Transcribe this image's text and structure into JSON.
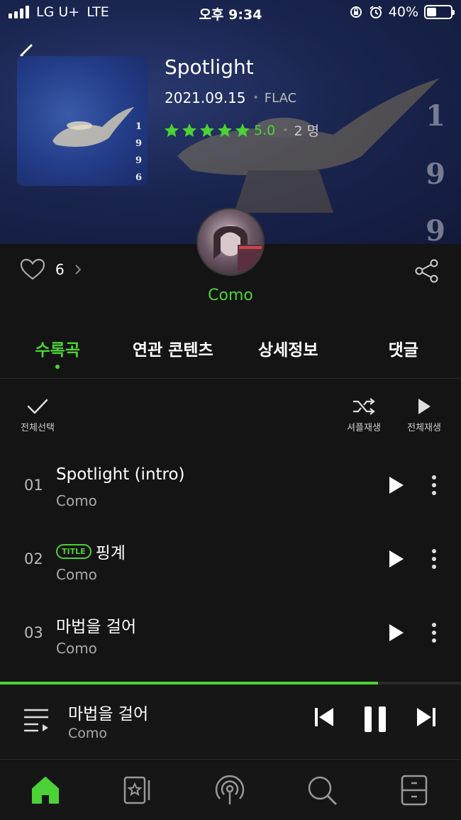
{
  "status_bar": {
    "carrier": "LG U+",
    "network": "LTE",
    "time": "오후 9:34",
    "battery": "40%",
    "battery_level": 0.4
  },
  "album": {
    "title": "Spotlight",
    "release_date": "2021.09.15",
    "format": "FLAC",
    "rating": "5.0",
    "rating_count": "2 명",
    "art_numbers": [
      "1",
      "9",
      "9",
      "6"
    ]
  },
  "artist": {
    "name": "Como"
  },
  "likes": {
    "count": "6"
  },
  "tabs": [
    {
      "label": "수록곡",
      "active": true
    },
    {
      "label": "연관 콘텐츠",
      "active": false
    },
    {
      "label": "상세정보",
      "active": false
    },
    {
      "label": "댓글",
      "active": false
    }
  ],
  "actions": {
    "select_all": "전체선택",
    "shuffle": "셔플재생",
    "play_all": "전체재생"
  },
  "tracks": [
    {
      "num": "01",
      "title": "Spotlight (intro)",
      "artist": "Como",
      "badge": ""
    },
    {
      "num": "02",
      "title": "핑계",
      "artist": "Como",
      "badge": "TITLE"
    },
    {
      "num": "03",
      "title": "마법을 걸어",
      "artist": "Como",
      "badge": ""
    }
  ],
  "now_playing": {
    "title": "마법을 걸어",
    "artist": "Como",
    "progress": 0.82
  },
  "colors": {
    "accent": "#4cd137",
    "background": "#141414"
  }
}
